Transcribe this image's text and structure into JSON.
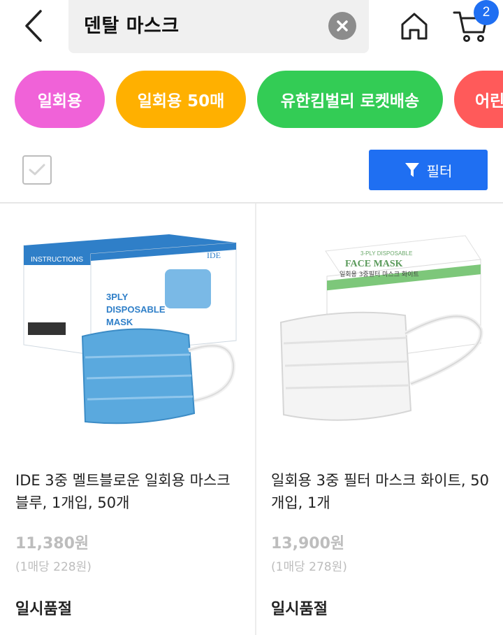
{
  "header": {
    "search_query": "덴탈 마스크",
    "cart_count": "2"
  },
  "chips": [
    {
      "label": "일회용",
      "color": "#f062d8"
    },
    {
      "label": "일회용 50매",
      "color": "#ffb000"
    },
    {
      "label": "유한킴벌리 로켓배송",
      "color": "#33cc55"
    },
    {
      "label": "어린",
      "color": "#ff5a5a"
    }
  ],
  "toolbar": {
    "filter_label": "필터"
  },
  "products": [
    {
      "title": "IDE 3중 멜트블로운 일회용 마스크 블루, 1개입, 50개",
      "price": "11,380원",
      "unit_price": "(1매당 228원)",
      "status": "일시품절",
      "image": {
        "box_brand": "IDE",
        "box_text": "3PLY DISPOSABLE MASK",
        "box_side_text": "INSTRUCTIONS",
        "mask_color": "#5aa9de"
      }
    },
    {
      "title": "일회용 3중 필터 마스크 화이트, 50개입, 1개",
      "price": "13,900원",
      "unit_price": "(1매당 278원)",
      "status": "일시품절",
      "image": {
        "box_text": "FACE MASK",
        "box_subtext": "3-PLY DISPOSABLE",
        "box_kor": "일회용 3중필터 마스크 화이트",
        "mask_color": "#f4f4f4"
      }
    }
  ]
}
